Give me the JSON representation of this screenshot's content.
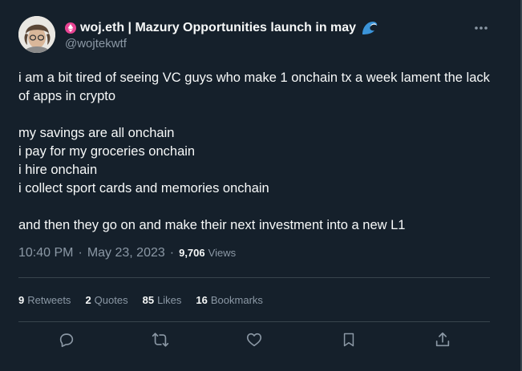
{
  "author": {
    "display_name": "woj.eth | Mazury Opportunities launch in may",
    "handle": "@wojtekwtf"
  },
  "tweet": {
    "lines": [
      "i am a bit tired of seeing VC guys who make 1 onchain tx a week lament the lack of apps in crypto",
      "",
      "my savings are all onchain",
      "i pay for my groceries onchain",
      "i hire onchain",
      "i collect sport cards and memories onchain",
      "",
      "and then they go on and make their next investment into a new L1"
    ],
    "time": "10:40 PM",
    "date": "May 23, 2023",
    "separator": "·",
    "views_count": "9,706",
    "views_label": "Views"
  },
  "stats": {
    "retweets_count": "9",
    "retweets_label": "Retweets",
    "quotes_count": "2",
    "quotes_label": "Quotes",
    "likes_count": "85",
    "likes_label": "Likes",
    "bookmarks_count": "16",
    "bookmarks_label": "Bookmarks"
  },
  "icons": {
    "more": "more-icon",
    "reply": "reply-icon",
    "retweet": "retweet-icon",
    "like": "heart-icon",
    "bookmark": "bookmark-icon",
    "share": "share-icon"
  },
  "colors": {
    "background": "#15202b",
    "text": "#f7f9f9",
    "secondary": "#8b98a5",
    "border": "#38444d",
    "badge": "#e84393"
  }
}
